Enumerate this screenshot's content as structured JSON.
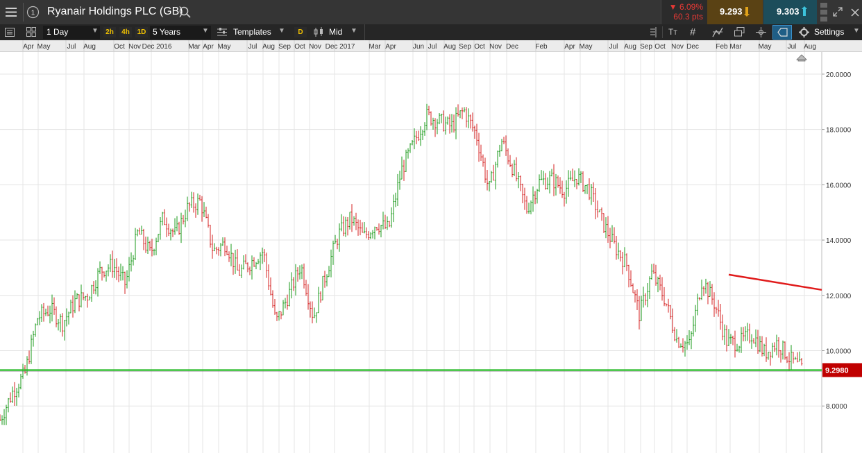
{
  "header": {
    "title": "Ryanair Holdings PLC (GB)",
    "change_pct": "▼ 6.09%",
    "change_pts": "60.3 pts",
    "sell_price": "9.293",
    "buy_price": "9.303"
  },
  "toolbar": {
    "interval": "1 Day",
    "quick_intervals": [
      "2h",
      "4h",
      "1D"
    ],
    "range": "5 Years",
    "templates_label": "Templates",
    "d_label": "D",
    "price_mode": "Mid",
    "settings_label": "Settings"
  },
  "icons": {
    "menu": "hamburger-icon",
    "info": "info-circle-icon",
    "search": "search-icon",
    "sell_arrow": "down-arrow-icon",
    "buy_arrow": "up-arrow-icon",
    "scroll": "scrollbar-icon",
    "expand": "expand-icon",
    "close": "close-icon",
    "list": "list-icon",
    "grid": "layout-grid-icon",
    "templates": "templates-icon",
    "candles": "candlestick-icon",
    "text_tool": "text-size-icon",
    "hash": "grid-icon",
    "draw": "drawing-icon",
    "windows": "windows-icon",
    "crosshair": "crosshair-icon",
    "tag": "tag-icon",
    "settings": "gear-icon"
  },
  "colors": {
    "up": "#1a9a1a",
    "down": "#d42020",
    "support_line": "#1fb81f",
    "trend_line": "#e01b1b",
    "price_badge": "#c00000",
    "buy_bg": "#1c4d5b",
    "sell_bg": "#5a4214"
  },
  "chart_data": {
    "type": "line",
    "title": "",
    "xlabel": "",
    "ylabel": "",
    "x_tick_labels": [
      "Apr",
      "May",
      "Jul",
      "Aug",
      "Oct",
      "Nov",
      "Dec 2016",
      "Mar",
      "Apr",
      "May",
      "Jul",
      "Aug",
      "Sep",
      "Oct",
      "Nov",
      "Dec 2017",
      "Mar",
      "Apr",
      "Jun",
      "Jul",
      "Aug",
      "Sep",
      "Oct",
      "Nov",
      "Dec",
      "Feb",
      "Apr",
      "May",
      "Jul",
      "Aug",
      "Sep",
      "Oct",
      "Nov",
      "Dec",
      "Feb",
      "Mar",
      "May",
      "Jul",
      "Aug"
    ],
    "y_ticks": [
      "20.0000",
      "18.0000",
      "16.0000",
      "14.0000",
      "12.0000",
      "10.0000",
      "8.0000"
    ],
    "ylim": [
      6.3,
      20.8
    ],
    "grid": true,
    "current_price_label": "9.2980",
    "current_price": 9.298,
    "series": [
      {
        "values": [
          7.5,
          8.5,
          9.2,
          11.2,
          11.5,
          11.0,
          11.8,
          12.0,
          12.9,
          13.1,
          12.4,
          14.3,
          13.5,
          14.8,
          14.2,
          15.2,
          15.4,
          13.6,
          13.9,
          12.8,
          13.2,
          13.6,
          11.0,
          12.0,
          13.1,
          11.2,
          12.8,
          14.2,
          14.8,
          14.1,
          14.6,
          14.4,
          16.5,
          17.5,
          18.5,
          18.3,
          18.1,
          18.7,
          17.8,
          15.8,
          17.6,
          16.5,
          15.1,
          16.1,
          16.2,
          15.8,
          16.3,
          15.8,
          14.7,
          13.8,
          13.1,
          11.3,
          12.8,
          11.9,
          10.4,
          10.2,
          12.6,
          11.7,
          10.3,
          10.3,
          10.6,
          9.9,
          10.3,
          9.7,
          9.3
        ]
      }
    ],
    "annotations": [
      {
        "type": "horizontal_line",
        "y": 9.298
      },
      {
        "type": "trend_line",
        "y_start": 12.75,
        "y_end": 12.2
      }
    ]
  }
}
